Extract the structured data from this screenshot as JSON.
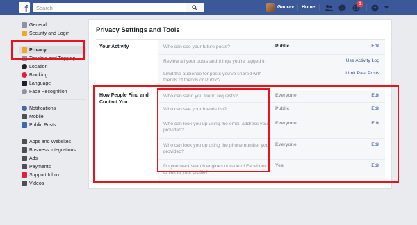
{
  "topbar": {
    "logo": "f",
    "search_placeholder": "Search",
    "user_name": "Gaurav",
    "home": "Home",
    "notification_count": "1",
    "colors": {
      "bar": "#3b5998",
      "badge": "#fa3e3e"
    }
  },
  "sidebar": {
    "groups": [
      [
        {
          "label": "General",
          "icon": "gear-icon"
        },
        {
          "label": "Security and Login",
          "icon": "shield-icon"
        }
      ],
      [
        {
          "label": "Privacy",
          "icon": "lock-icon",
          "active": true
        },
        {
          "label": "Timeline and Tagging",
          "icon": "timeline-icon"
        },
        {
          "label": "Location",
          "icon": "location-icon"
        },
        {
          "label": "Blocking",
          "icon": "blocking-icon"
        },
        {
          "label": "Language",
          "icon": "language-icon"
        },
        {
          "label": "Face Recognition",
          "icon": "face-recognition-icon"
        }
      ],
      [
        {
          "label": "Notifications",
          "icon": "globe-icon"
        },
        {
          "label": "Mobile",
          "icon": "mobile-icon"
        },
        {
          "label": "Public Posts",
          "icon": "rss-icon"
        }
      ],
      [
        {
          "label": "Apps and Websites",
          "icon": "apps-icon"
        },
        {
          "label": "Business Integrations",
          "icon": "business-icon"
        },
        {
          "label": "Ads",
          "icon": "ads-icon"
        },
        {
          "label": "Payments",
          "icon": "payments-icon"
        },
        {
          "label": "Support Inbox",
          "icon": "support-icon"
        },
        {
          "label": "Videos",
          "icon": "video-icon"
        }
      ]
    ]
  },
  "main": {
    "title": "Privacy Settings and Tools",
    "sections": [
      {
        "label": "Your Activity",
        "rows": [
          {
            "question": "Who can see your future posts?",
            "value": "Public",
            "action": "Edit"
          },
          {
            "question": "Review all your posts and things you're tagged in",
            "value": "",
            "action": "Use Activity Log"
          },
          {
            "question": "Limit the audience for posts you've shared with friends of friends or Public?",
            "value": "",
            "action": "Limit Past Posts"
          }
        ]
      },
      {
        "label": "How People Find and Contact You",
        "rows": [
          {
            "question": "Who can send you friend requests?",
            "value": "Everyone",
            "action": "Edit"
          },
          {
            "question": "Who can see your friends list?",
            "value": "Public",
            "action": "Edit"
          },
          {
            "question": "Who can look you up using the email address you provided?",
            "value": "Everyone",
            "action": "Edit"
          },
          {
            "question": "Who can look you up using the phone number you provided?",
            "value": "Everyone",
            "action": "Edit"
          },
          {
            "question": "Do you want search engines outside of Facebook to link to your profile?",
            "value": "Yes",
            "action": "Edit"
          }
        ]
      }
    ]
  },
  "highlight_color": "#e8141c"
}
